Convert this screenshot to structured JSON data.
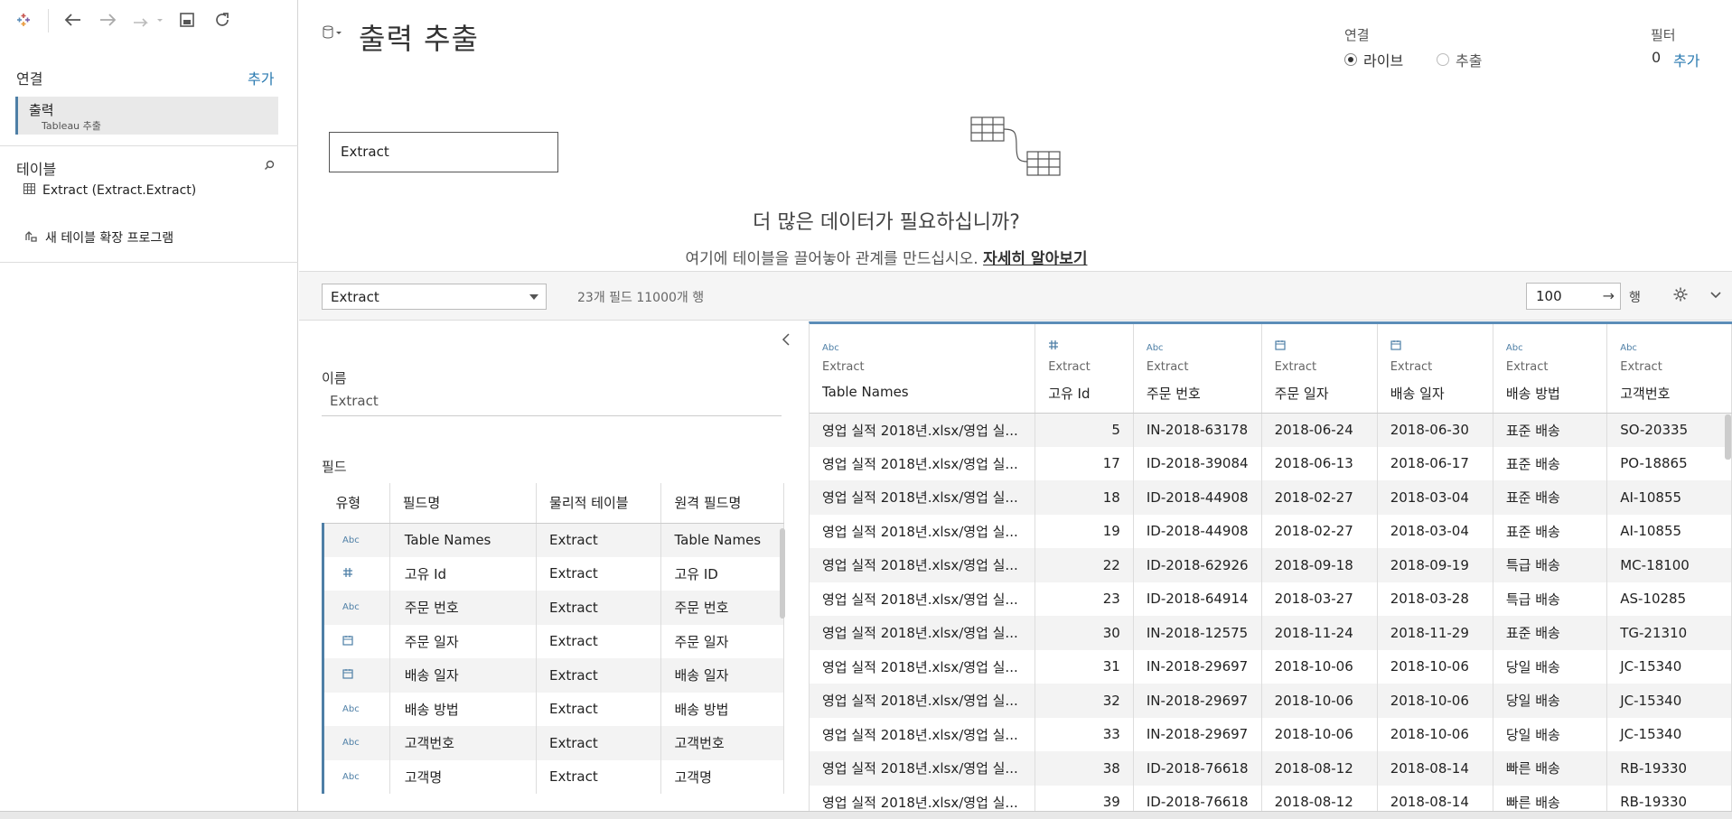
{
  "toolbar": {
    "icons": [
      "tableau-logo-icon",
      "back-icon",
      "forward-icon",
      "redo-icon",
      "save-icon",
      "refresh-icon"
    ]
  },
  "sidebar": {
    "connections_title": "연결",
    "add_label": "추가",
    "connection": {
      "name": "출력",
      "subtitle": "Tableau 추출"
    },
    "tables_title": "테이블",
    "table_item": "Extract (Extract.Extract)",
    "extension_label": "새 테이블 확장 프로그램"
  },
  "canvas": {
    "title": "출력 추출",
    "connection_label": "연결",
    "live_label": "라이브",
    "extract_label": "추출",
    "selected_connection": "live",
    "filter_label": "필터",
    "filter_count": "0",
    "filter_add": "추가",
    "logical_table": "Extract",
    "more_data_title": "더 많은 데이터가 필요하십니까?",
    "more_data_text": "여기에 테이블을 끌어놓아 관계를 만드십시오.",
    "learn_more": "자세히 알아보기"
  },
  "databar": {
    "table_select": "Extract",
    "field_count": "23개 필드 11000개 행",
    "rows_value": "100",
    "rows_label": "행"
  },
  "metadata": {
    "name_label": "이름",
    "name_value": "Extract",
    "fields_label": "필드",
    "columns": [
      "유형",
      "필드명",
      "물리적 테이블",
      "원격 필드명"
    ],
    "rows": [
      {
        "type": "Abc",
        "name": "Table Names",
        "table": "Extract",
        "remote": "Table Names"
      },
      {
        "type": "#",
        "name": "고유 Id",
        "table": "Extract",
        "remote": "고유 ID"
      },
      {
        "type": "Abc",
        "name": "주문 번호",
        "table": "Extract",
        "remote": "주문 번호"
      },
      {
        "type": "date",
        "name": "주문 일자",
        "table": "Extract",
        "remote": "주문 일자"
      },
      {
        "type": "date",
        "name": "배송 일자",
        "table": "Extract",
        "remote": "배송 일자"
      },
      {
        "type": "Abc",
        "name": "배송 방법",
        "table": "Extract",
        "remote": "배송 방법"
      },
      {
        "type": "Abc",
        "name": "고객번호",
        "table": "Extract",
        "remote": "고객번호"
      },
      {
        "type": "Abc",
        "name": "고객명",
        "table": "Extract",
        "remote": "고객명"
      }
    ]
  },
  "grid": {
    "columns": [
      {
        "type": "Abc",
        "source": "Extract",
        "name": "Table Names"
      },
      {
        "type": "#",
        "source": "Extract",
        "name": "고유 Id"
      },
      {
        "type": "Abc",
        "source": "Extract",
        "name": "주문 번호"
      },
      {
        "type": "date",
        "source": "Extract",
        "name": "주문 일자"
      },
      {
        "type": "date",
        "source": "Extract",
        "name": "배송 일자"
      },
      {
        "type": "Abc",
        "source": "Extract",
        "name": "배송 방법"
      },
      {
        "type": "Abc",
        "source": "Extract",
        "name": "고객번호"
      }
    ],
    "rows": [
      [
        "영업 실적 2018년.xlsx/영업 실...",
        "5",
        "IN-2018-63178",
        "2018-06-24",
        "2018-06-30",
        "표준 배송",
        "SO-20335"
      ],
      [
        "영업 실적 2018년.xlsx/영업 실...",
        "17",
        "ID-2018-39084",
        "2018-06-13",
        "2018-06-17",
        "표준 배송",
        "PO-18865"
      ],
      [
        "영업 실적 2018년.xlsx/영업 실...",
        "18",
        "ID-2018-44908",
        "2018-02-27",
        "2018-03-04",
        "표준 배송",
        "AI-10855"
      ],
      [
        "영업 실적 2018년.xlsx/영업 실...",
        "19",
        "ID-2018-44908",
        "2018-02-27",
        "2018-03-04",
        "표준 배송",
        "AI-10855"
      ],
      [
        "영업 실적 2018년.xlsx/영업 실...",
        "22",
        "ID-2018-62926",
        "2018-09-18",
        "2018-09-19",
        "특급 배송",
        "MC-18100"
      ],
      [
        "영업 실적 2018년.xlsx/영업 실...",
        "23",
        "ID-2018-64914",
        "2018-03-27",
        "2018-03-28",
        "특급 배송",
        "AS-10285"
      ],
      [
        "영업 실적 2018년.xlsx/영업 실...",
        "30",
        "IN-2018-12575",
        "2018-11-24",
        "2018-11-29",
        "표준 배송",
        "TG-21310"
      ],
      [
        "영업 실적 2018년.xlsx/영업 실...",
        "31",
        "IN-2018-29697",
        "2018-10-06",
        "2018-10-06",
        "당일 배송",
        "JC-15340"
      ],
      [
        "영업 실적 2018년.xlsx/영업 실...",
        "32",
        "IN-2018-29697",
        "2018-10-06",
        "2018-10-06",
        "당일 배송",
        "JC-15340"
      ],
      [
        "영업 실적 2018년.xlsx/영업 실...",
        "33",
        "IN-2018-29697",
        "2018-10-06",
        "2018-10-06",
        "당일 배송",
        "JC-15340"
      ],
      [
        "영업 실적 2018년.xlsx/영업 실...",
        "38",
        "ID-2018-76618",
        "2018-08-12",
        "2018-08-14",
        "빠른 배송",
        "RB-19330"
      ],
      [
        "영업 실적 2018년.xlsx/영업 실...",
        "39",
        "ID-2018-76618",
        "2018-08-12",
        "2018-08-14",
        "빠른 배송",
        "RB-19330"
      ]
    ]
  },
  "colors": {
    "accent": "#4e7fa6",
    "link": "#2a7ab0",
    "grid_top": "#5b8db8"
  }
}
